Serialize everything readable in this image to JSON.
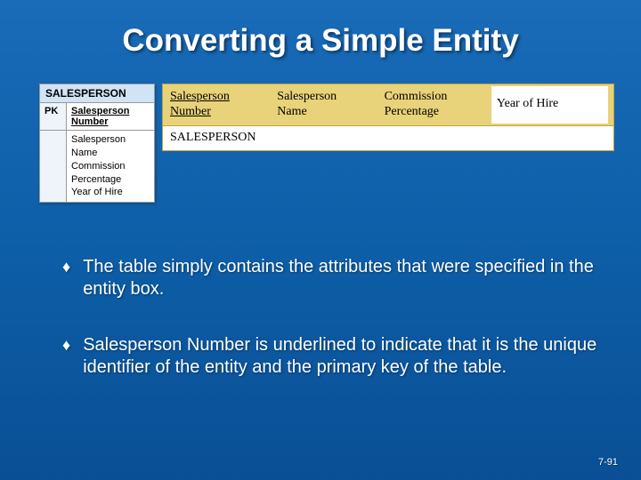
{
  "title": "Converting a Simple Entity",
  "entity": {
    "name": "SALESPERSON",
    "pk_label": "PK",
    "pk_value": "Salesperson Number",
    "attrs": [
      "Salesperson",
      "Name",
      "Commission",
      "Percentage",
      "Year of Hire"
    ]
  },
  "relation": {
    "columns": [
      {
        "label": "Salesperson Number",
        "underlined": true
      },
      {
        "label": "Salesperson Name",
        "underlined": false
      },
      {
        "label": "Commission Percentage",
        "underlined": false
      },
      {
        "label": "Year of Hire",
        "underlined": false
      }
    ],
    "name": "SALESPERSON"
  },
  "bullets": [
    "The table simply contains the attributes that were specified in the entity box.",
    "Salesperson Number is underlined to indicate that it is the unique identifier of the entity and the primary key of the table."
  ],
  "page_number": "7-91"
}
